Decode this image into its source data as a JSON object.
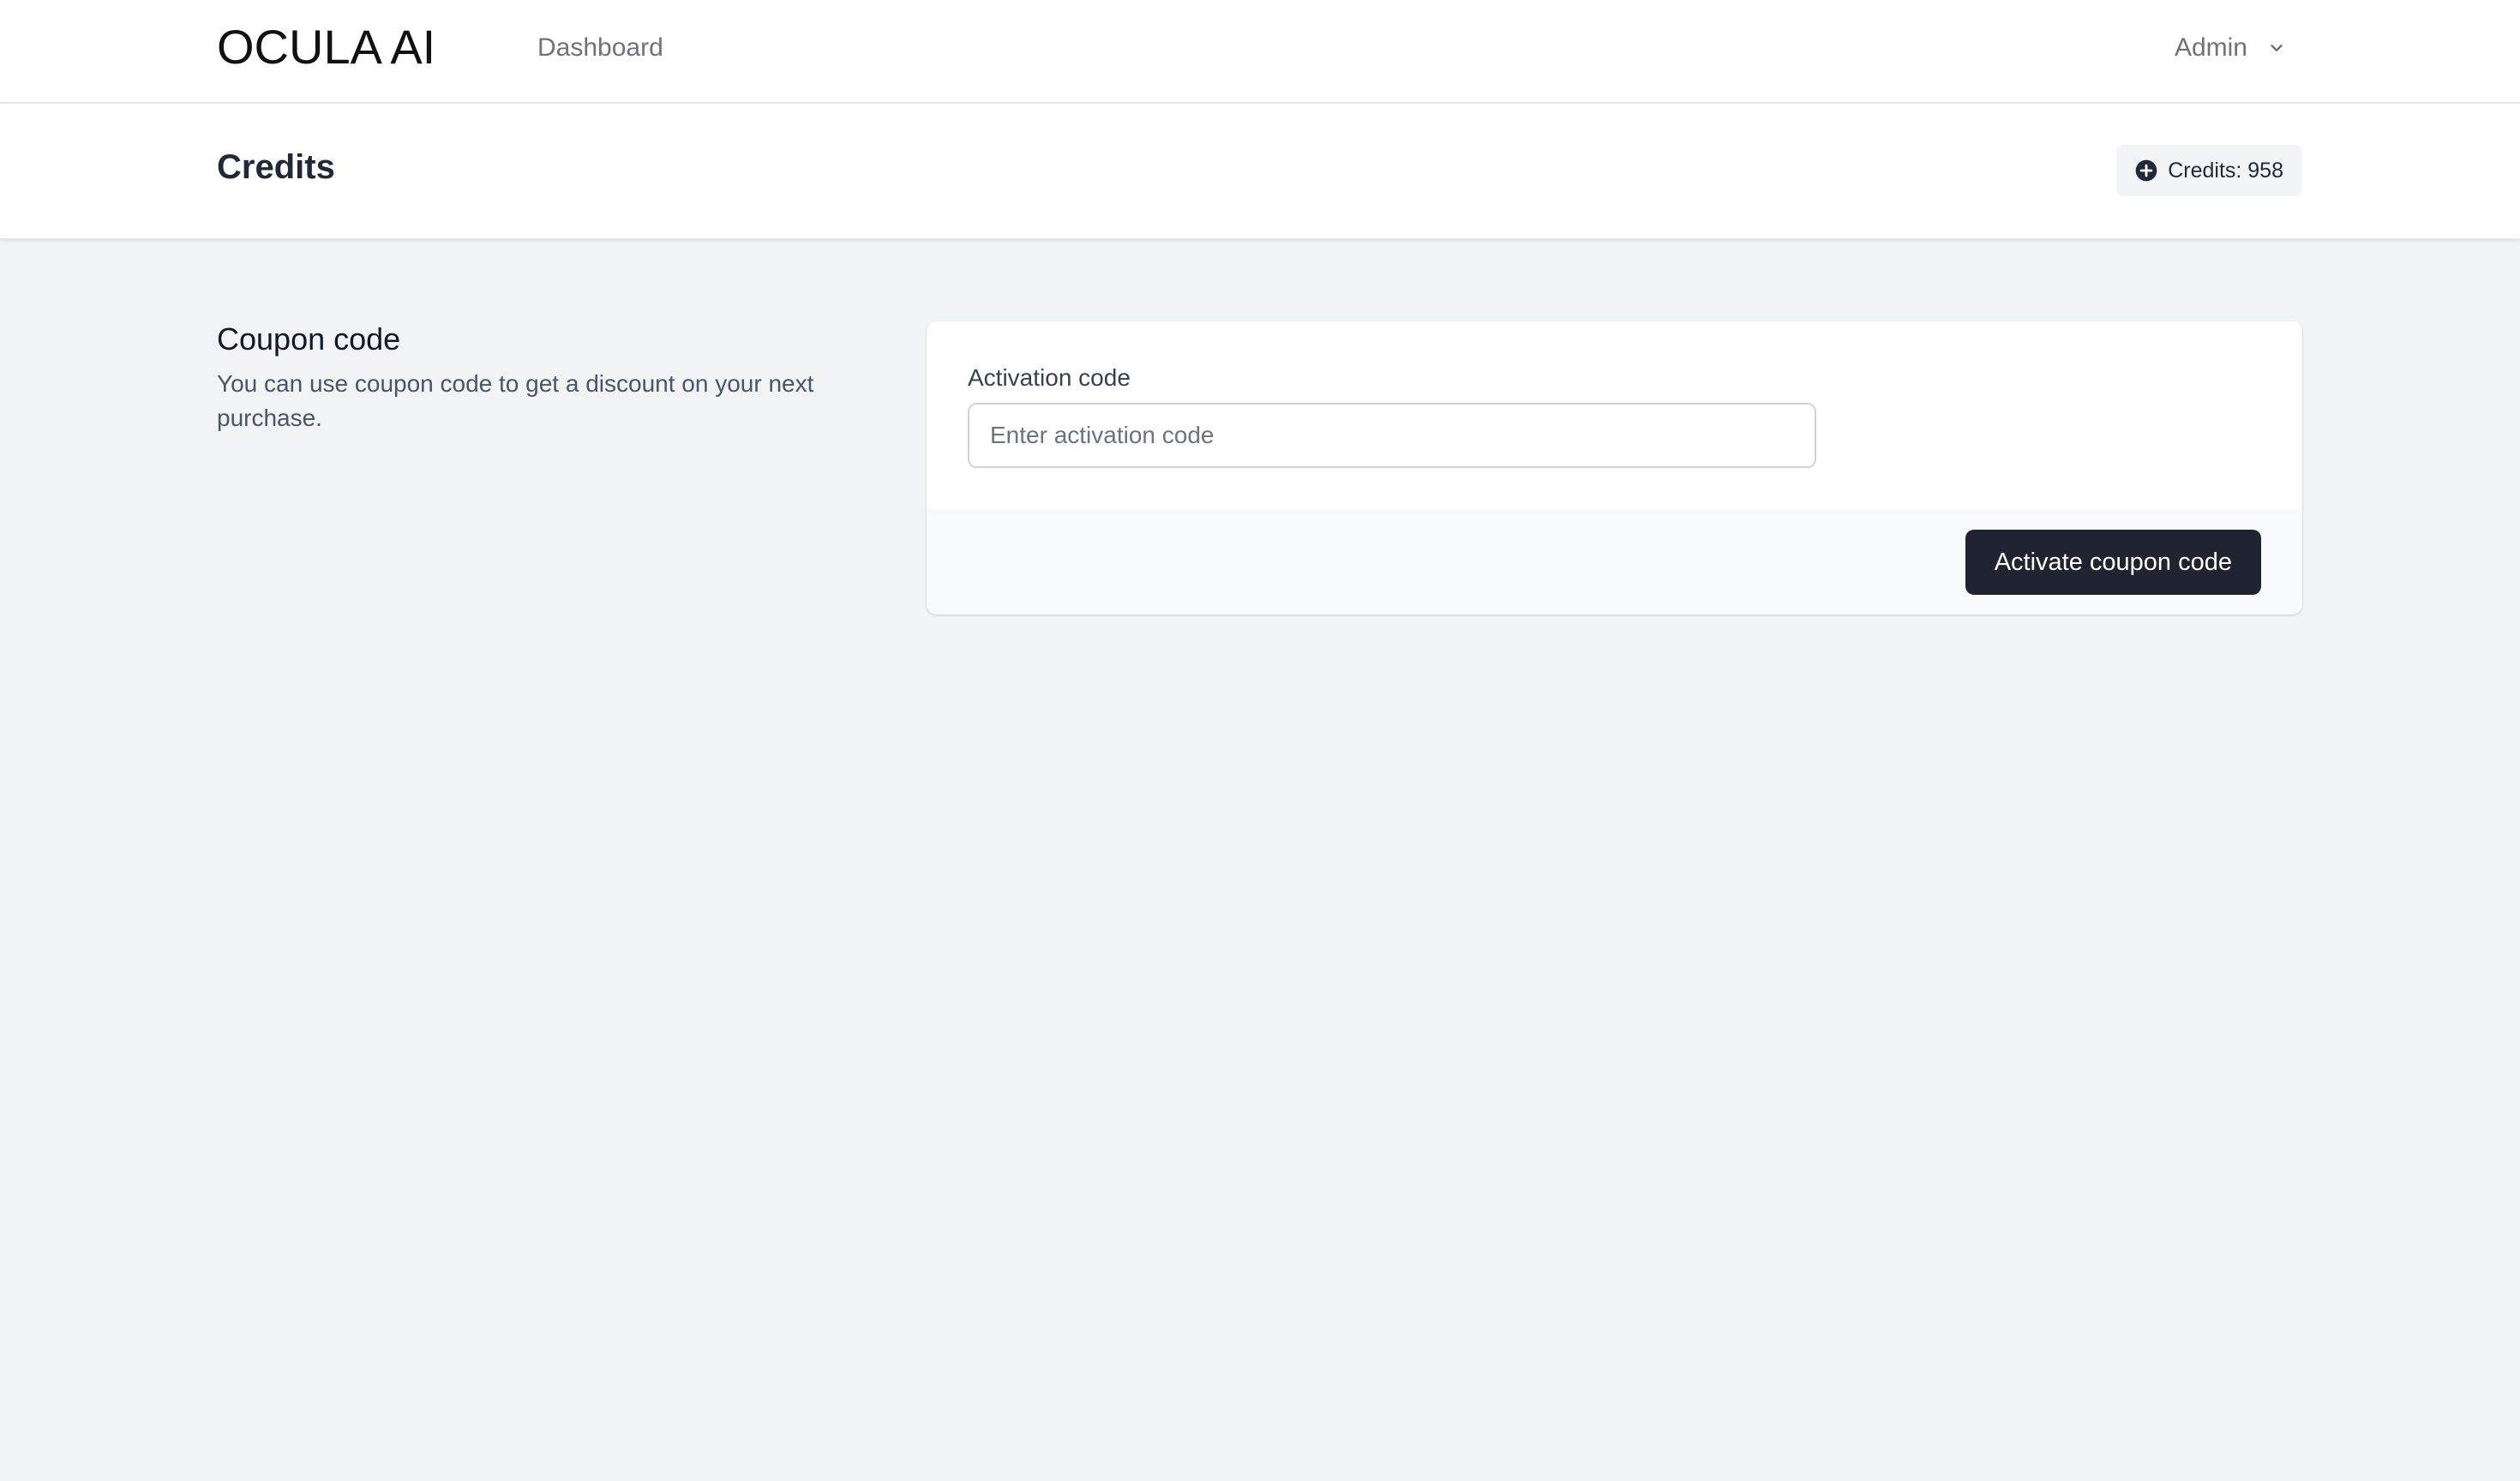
{
  "header": {
    "logo_text": "OCULA AI",
    "nav_items": [
      {
        "label": "Dashboard"
      }
    ],
    "user_menu": {
      "label": "Admin",
      "icon": "chevron-down-icon"
    }
  },
  "page": {
    "title": "Credits",
    "credits_badge": {
      "icon": "plus-circle-icon",
      "label": "Credits: 958"
    }
  },
  "coupon_section": {
    "title": "Coupon code",
    "description": "You can use coupon code to get a discount on your next purchase.",
    "field_label": "Activation code",
    "input_value": "",
    "input_placeholder": "Enter activation code",
    "submit_label": "Activate coupon code"
  },
  "colors": {
    "page_background": "#f2f3f5",
    "surface": "#ffffff",
    "primary_button": "#1f2430",
    "muted_text": "#6b7280",
    "badge_background": "#f3f4f6"
  }
}
